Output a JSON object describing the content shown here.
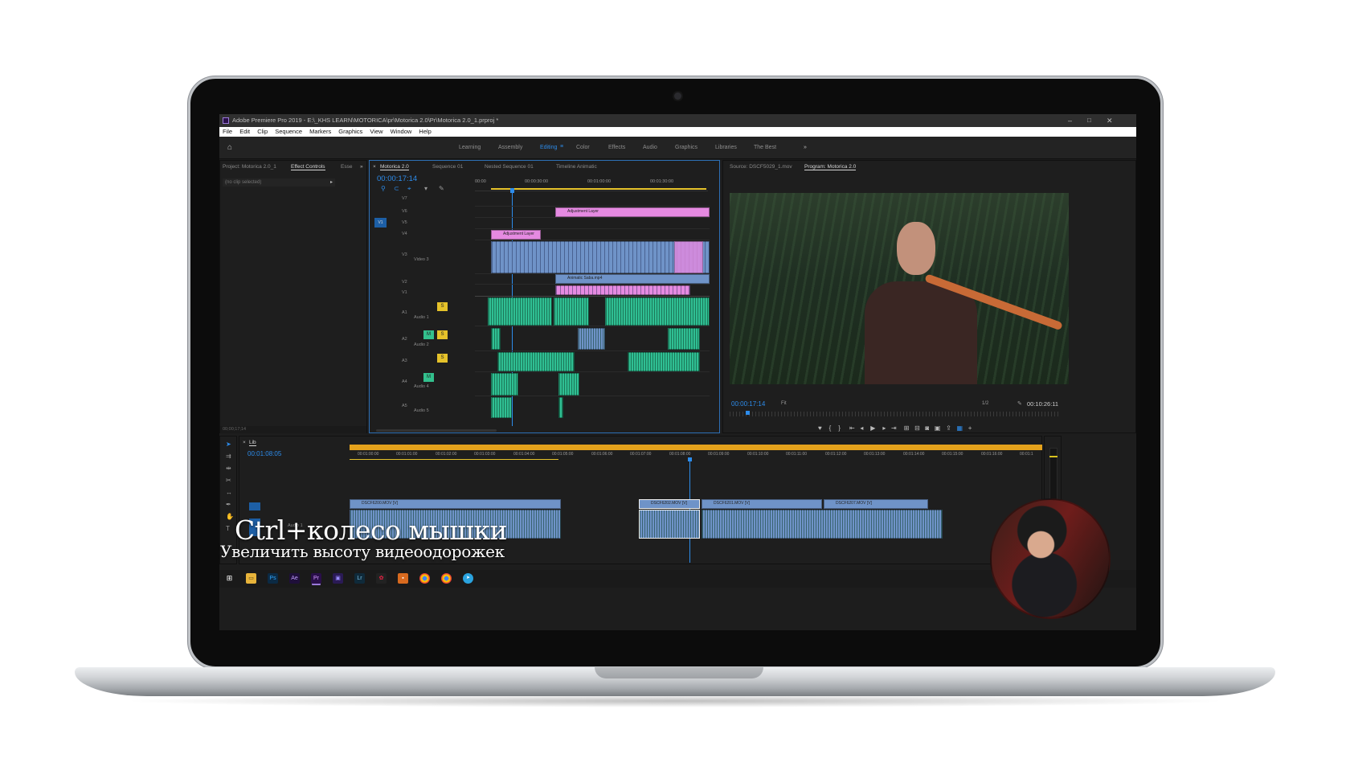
{
  "app": {
    "window_title": "Adobe Premiere Pro 2019 - E:\\_KHS LEARN\\MOTORICA\\pr\\Motorica 2.0\\Pr\\Motorica 2.0_1.prproj *",
    "menu": [
      "File",
      "Edit",
      "Clip",
      "Sequence",
      "Markers",
      "Graphics",
      "View",
      "Window",
      "Help"
    ],
    "workspaces": [
      "Learning",
      "Assembly",
      "Editing",
      "Color",
      "Effects",
      "Audio",
      "Graphics",
      "Libraries",
      "The Best"
    ],
    "active_workspace": "Editing"
  },
  "left_panel": {
    "tabs": [
      "Project: Motorica 2.0_1",
      "Effect Controls",
      "Esse"
    ],
    "active_tab": "Effect Controls",
    "no_clip": "(no clip selected)",
    "timecode": "00;00;17;14"
  },
  "timeline_top": {
    "tabs": [
      "Motorica 2.0",
      "Sequence 01",
      "Nested Sequence 01",
      "Timeline Animatic"
    ],
    "active_tab": "Motorica 2.0",
    "timecode": "00:00:17:14",
    "ruler": [
      "00:00",
      "00:00:30:00",
      "00:01:00:00",
      "00:01:30:00"
    ],
    "tracks": [
      "V7",
      "V6",
      "V5",
      "V4",
      "V3",
      "V2",
      "V1",
      "A1",
      "A2",
      "A3",
      "A4",
      "A5"
    ],
    "track_names": {
      "v3": "Video 3",
      "a1": "Audio 1",
      "a2": "Audio 2",
      "a4": "Audio 4",
      "a5": "Audio 5"
    },
    "clips": {
      "adjustment1": "Adjustment Layer",
      "adjustment2": "Adjustment Layer",
      "animatic": "Animatic Saba.mp4"
    },
    "labels": {
      "m": "M",
      "s": "S"
    }
  },
  "program_monitor": {
    "tabs": [
      "Source: DSCF5029_1.mov",
      "Program: Motorica 2.0"
    ],
    "active_tab": "Program: Motorica 2.0",
    "timecode": "00:00:17:14",
    "fit": "Fit",
    "resolution": "1/2",
    "duration": "00:10:26:11"
  },
  "timeline_bottom": {
    "tab": "Lib",
    "timecode": "00:01:08:05",
    "ruler": [
      "00:01:00:00",
      "00:01:01:00",
      "00:01:02:00",
      "00:01:03:00",
      "00:01:04:00",
      "00:01:05:00",
      "00:01:06:00",
      "00:01:07:00",
      "00:01:08:00",
      "00:01:09:00",
      "00:01:10:00",
      "00:01:11:00",
      "00:01:12:00",
      "00:01:13:00",
      "00:01:14:00",
      "00:01:15:00",
      "00:01:16:00",
      "00:01:1"
    ],
    "clips": [
      "DSCF6200.MOV [V]",
      "DSCF6202.MOV [V]",
      "DSCF6201.MOV [V]",
      "DSCF6207.MOV [V]"
    ],
    "track_name": "Audio 1",
    "meter": "S S"
  },
  "caption": {
    "title": "Ctrl+колесо мышки",
    "subtitle": "Увеличить высоту видеоодорожек"
  },
  "colors": {
    "accent": "#2d8ceb",
    "audio_clip": "#2fbf93",
    "video_clip": "#6f93c8",
    "adjustment_clip": "#e58ae1",
    "work_area": "#e5a21c"
  }
}
